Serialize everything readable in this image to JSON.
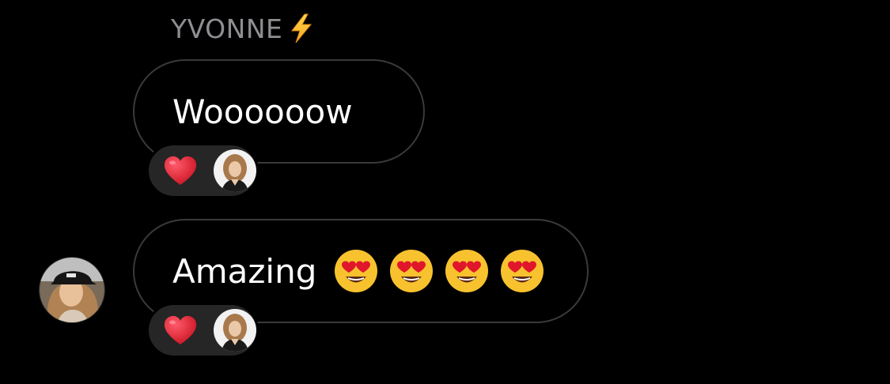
{
  "conversation": {
    "sender": {
      "name": "YVONNE",
      "name_icon": "lightning-bolt-icon"
    },
    "messages": [
      {
        "text": "Woooooow",
        "emojis": [],
        "reactions": [
          {
            "emoji": "heart-icon",
            "reactor": "user-avatar"
          }
        ]
      },
      {
        "text": "Amazing",
        "emojis": [
          "heart-eyes-face-icon",
          "heart-eyes-face-icon",
          "heart-eyes-face-icon",
          "heart-eyes-face-icon"
        ],
        "reactions": [
          {
            "emoji": "heart-icon",
            "reactor": "user-avatar"
          }
        ]
      }
    ]
  },
  "colors": {
    "background": "#000000",
    "bubble_border": "#3a3a3c",
    "reaction_pill": "#262626",
    "sender_name": "#8e8e93",
    "message_text": "#ffffff",
    "heart": "#e0162b",
    "emoji_face": "#f7c22e"
  }
}
